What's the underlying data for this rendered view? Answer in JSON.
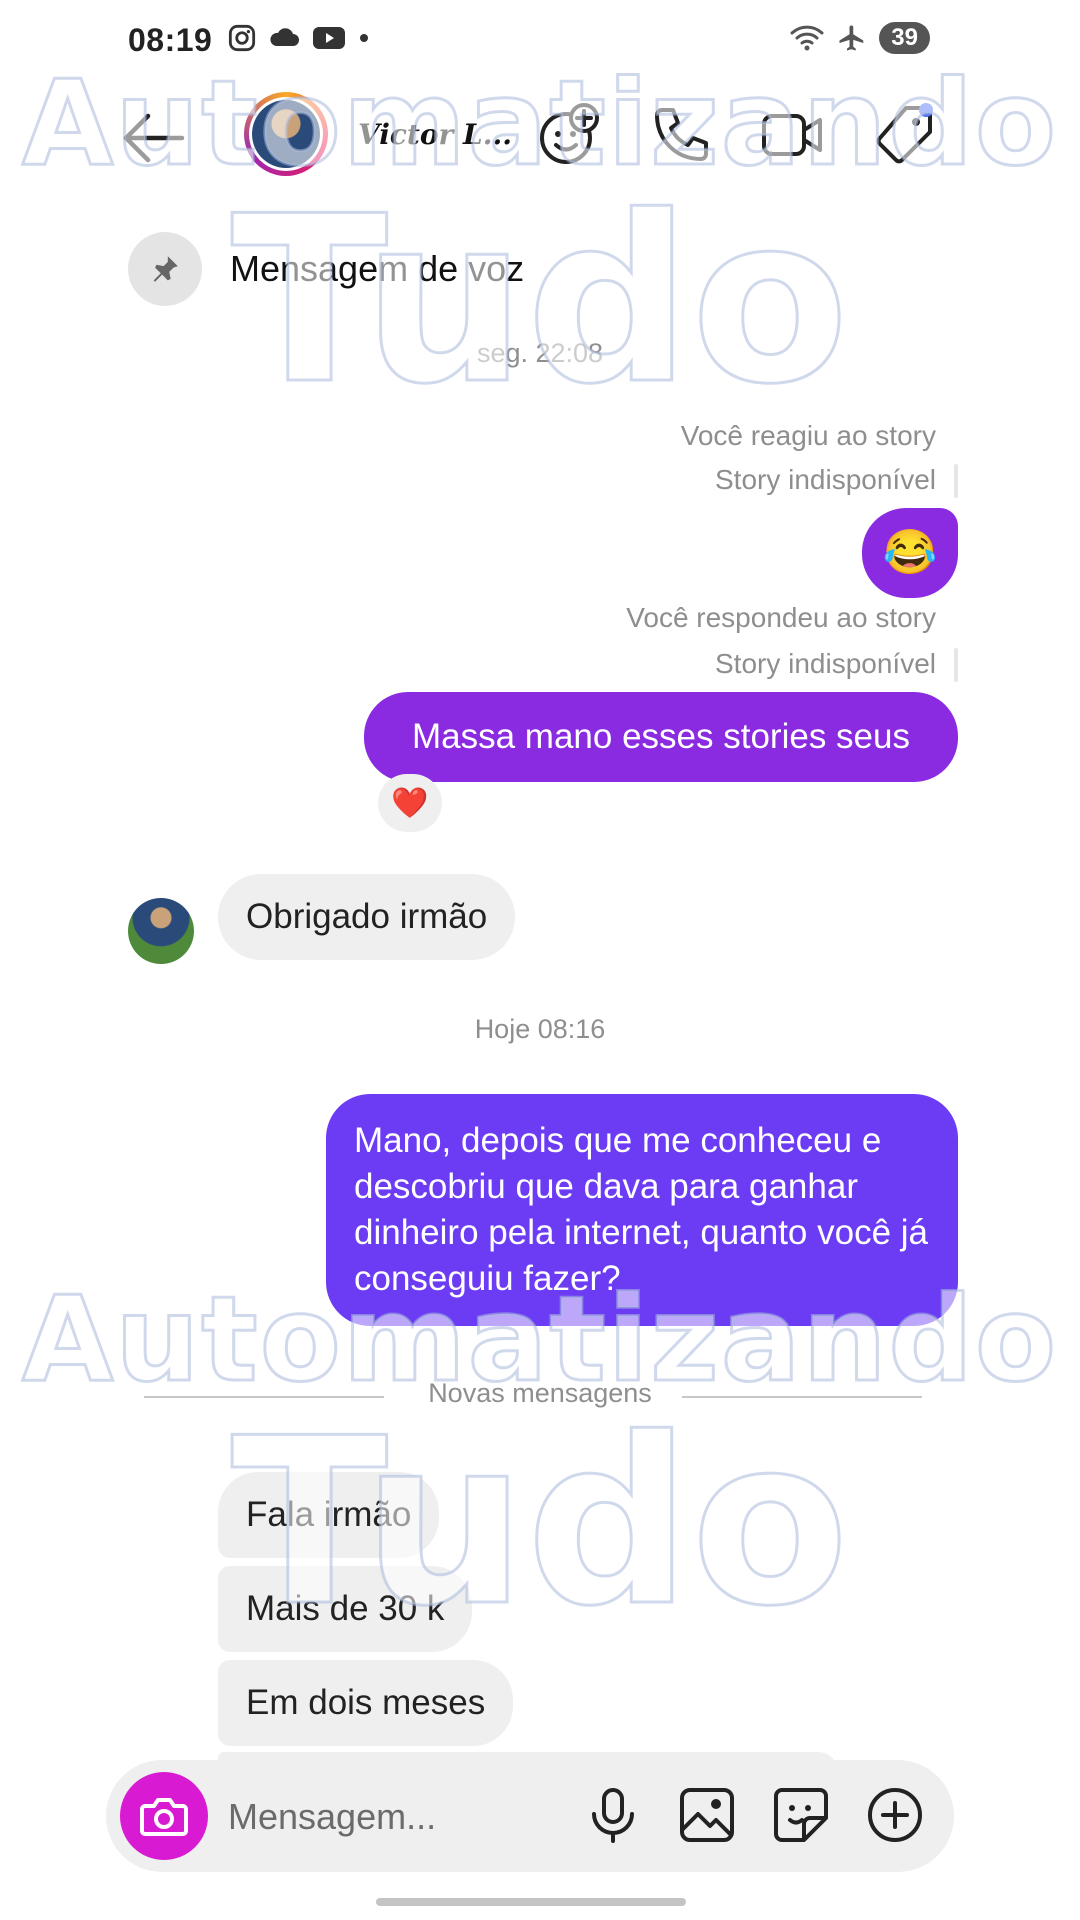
{
  "status_bar": {
    "time": "08:19",
    "battery": "39"
  },
  "header": {
    "contact_name": "Victor L..."
  },
  "pinned": {
    "label": "Mensagem de voz"
  },
  "thread": {
    "timestamp_1": "seg. 22:08",
    "reacted_note": "Você reagiu ao story",
    "story_unavailable_1": "Story indisponível",
    "emoji_message": "😂",
    "replied_note": "Você respondeu ao story",
    "story_unavailable_2": "Story indisponível",
    "msg_out_1": "Massa mano esses stories seus",
    "reaction_1": "❤️",
    "msg_in_1": "Obrigado irmão",
    "timestamp_2": "Hoje 08:16",
    "msg_out_2": "Mano, depois que me conheceu e descobriu que dava para ganhar dinheiro pela internet, quanto você já conseguiu fazer?",
    "new_messages_divider": "Novas mensagens",
    "msg_in_2": "Fala irmão",
    "msg_in_3": "Mais de 30 k",
    "msg_in_4": "Em dois meses"
  },
  "composer": {
    "placeholder": "Mensagem..."
  },
  "watermark": {
    "line1": "Automatizando",
    "line2": "Tudo"
  },
  "colors": {
    "bubble_purple": "#8a2be2",
    "bubble_violet": "#6c3cf5",
    "camera_magenta": "#d81bd2"
  },
  "icons": {
    "back": "arrow-left-icon",
    "effects": "face-add-icon",
    "call": "phone-icon",
    "video": "video-camera-icon",
    "tag": "tag-icon",
    "pin": "pin-icon",
    "camera": "camera-icon",
    "mic": "microphone-icon",
    "gallery": "image-icon",
    "sticker": "sticker-icon",
    "add": "plus-circle-icon"
  }
}
